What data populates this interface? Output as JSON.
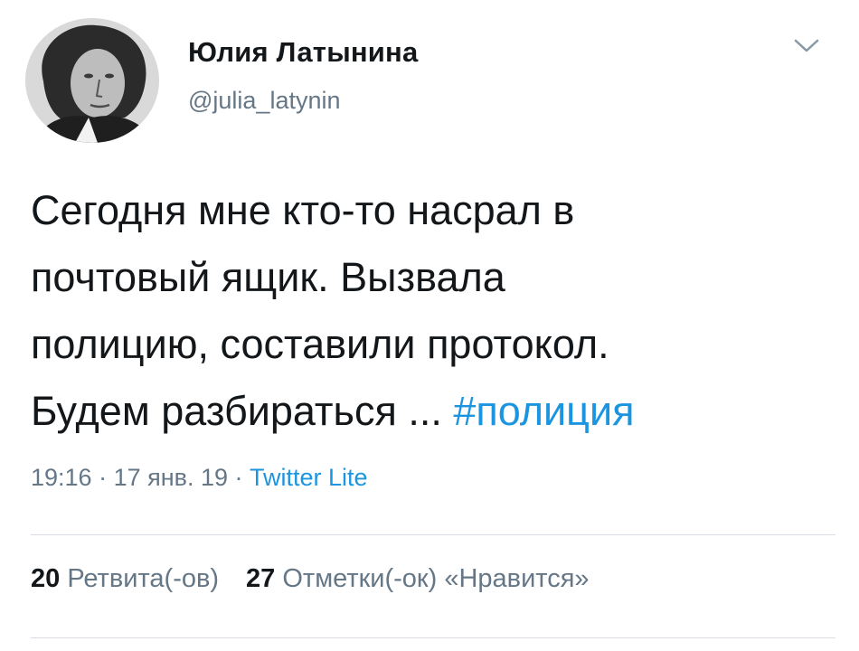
{
  "author": {
    "name": "Юлия Латынина",
    "handle": "@julia_latynin"
  },
  "tweet": {
    "text": "Сегодня мне кто-то насрал в\nпочтовый ящик. Вызвала\nполицию, составили протокол.\nБудем разбираться ... ",
    "hashtag": "#полиция"
  },
  "meta": {
    "time": "19:16",
    "separator1": " · ",
    "date": "17 янв. 19",
    "separator2": " · ",
    "source": "Twitter Lite"
  },
  "stats": {
    "retweets_count": "20",
    "retweets_label": "Ретвита(-ов)",
    "likes_count": "27",
    "likes_label": "Отметки(-ок) «Нравится»"
  },
  "icons": {
    "menu": "chevron-down-icon"
  },
  "colors": {
    "link": "#1b95e0",
    "secondary": "#657786",
    "text": "#14171a"
  }
}
